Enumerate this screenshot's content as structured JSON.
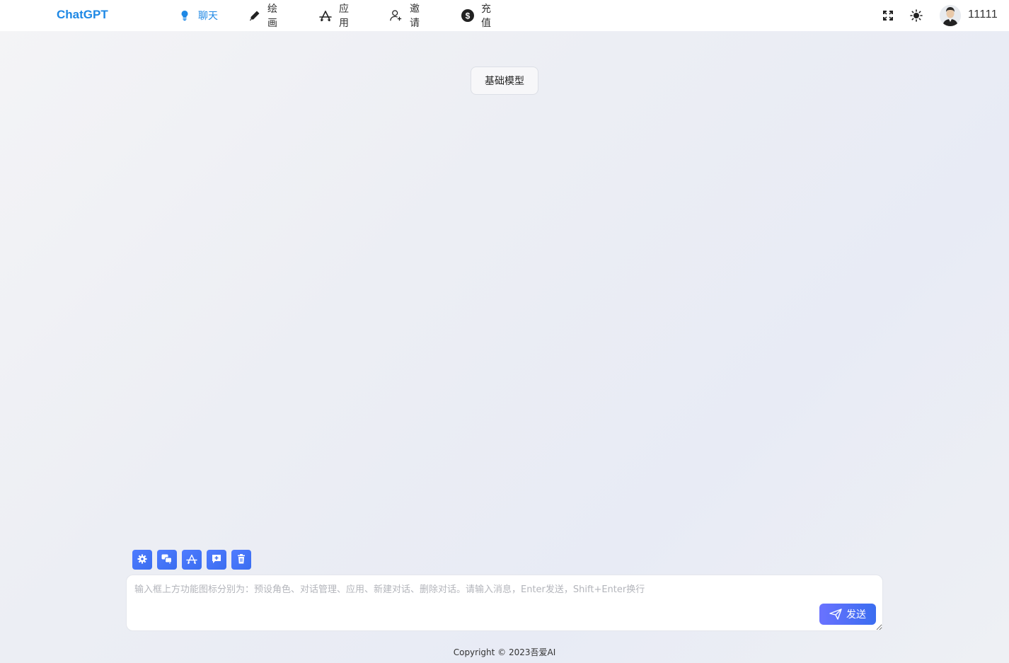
{
  "brand": "ChatGPT",
  "nav": {
    "chat": "聊天",
    "draw": "绘画",
    "apps": "应用",
    "invite": "邀请",
    "recharge": "充值"
  },
  "user": {
    "name": "11111"
  },
  "model_button": "基础模型",
  "input": {
    "placeholder": "输入框上方功能图标分别为：预设角色、对话管理、应用、新建对话、删除对话。请输入消息，Enter发送，Shift+Enter换行",
    "value": ""
  },
  "send_label": "发送",
  "footer": "Copyright © 2023吾爱AI",
  "colors": {
    "accent": "#1e88e5",
    "button_blue": "#3a6df0"
  },
  "icons": [
    "lightbulb-icon",
    "pencil-icon",
    "app-store-icon",
    "add-user-icon",
    "dollar-icon",
    "fullscreen-icon",
    "sun-icon",
    "gear-icon",
    "chat-bubbles-icon",
    "apps-icon",
    "new-chat-icon",
    "trash-icon",
    "send-icon"
  ]
}
